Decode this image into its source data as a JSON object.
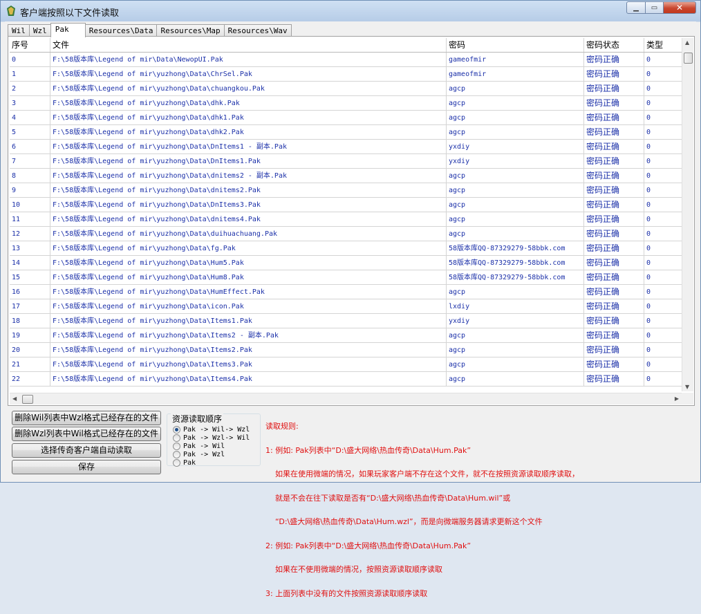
{
  "window": {
    "title": "客户端按照以下文件读取",
    "min_label": "▁",
    "max_label": "▭",
    "close_label": "✕"
  },
  "tabs": [
    "Wil",
    "Wzl",
    "Pak",
    "Resources\\Data",
    "Resources\\Map",
    "Resources\\Wav"
  ],
  "active_tab": "Pak",
  "table": {
    "headers": [
      "序号",
      "文件",
      "密码",
      "密码状态",
      "类型"
    ],
    "rows": [
      [
        "0",
        "F:\\58版本库\\Legend of mir\\Data\\NewopUI.Pak",
        "gameofmir",
        "密码正确",
        "0"
      ],
      [
        "1",
        "F:\\58版本库\\Legend of mir\\yuzhong\\Data\\ChrSel.Pak",
        "gameofmir",
        "密码正确",
        "0"
      ],
      [
        "2",
        "F:\\58版本库\\Legend of mir\\yuzhong\\Data\\chuangkou.Pak",
        "agcp",
        "密码正确",
        "0"
      ],
      [
        "3",
        "F:\\58版本库\\Legend of mir\\yuzhong\\Data\\dhk.Pak",
        "agcp",
        "密码正确",
        "0"
      ],
      [
        "4",
        "F:\\58版本库\\Legend of mir\\yuzhong\\Data\\dhk1.Pak",
        "agcp",
        "密码正确",
        "0"
      ],
      [
        "5",
        "F:\\58版本库\\Legend of mir\\yuzhong\\Data\\dhk2.Pak",
        "agcp",
        "密码正确",
        "0"
      ],
      [
        "6",
        "F:\\58版本库\\Legend of mir\\yuzhong\\Data\\DnItems1 - 副本.Pak",
        "yxdiy",
        "密码正确",
        "0"
      ],
      [
        "7",
        "F:\\58版本库\\Legend of mir\\yuzhong\\Data\\DnItems1.Pak",
        "yxdiy",
        "密码正确",
        "0"
      ],
      [
        "8",
        "F:\\58版本库\\Legend of mir\\yuzhong\\Data\\dnitems2 - 副本.Pak",
        "agcp",
        "密码正确",
        "0"
      ],
      [
        "9",
        "F:\\58版本库\\Legend of mir\\yuzhong\\Data\\dnitems2.Pak",
        "agcp",
        "密码正确",
        "0"
      ],
      [
        "10",
        "F:\\58版本库\\Legend of mir\\yuzhong\\Data\\DnItems3.Pak",
        "agcp",
        "密码正确",
        "0"
      ],
      [
        "11",
        "F:\\58版本库\\Legend of mir\\yuzhong\\Data\\dnitems4.Pak",
        "agcp",
        "密码正确",
        "0"
      ],
      [
        "12",
        "F:\\58版本库\\Legend of mir\\yuzhong\\Data\\duihuachuang.Pak",
        "agcp",
        "密码正确",
        "0"
      ],
      [
        "13",
        "F:\\58版本库\\Legend of mir\\yuzhong\\Data\\fg.Pak",
        "58版本库QQ-87329279-58bbk.com",
        "密码正确",
        "0"
      ],
      [
        "14",
        "F:\\58版本库\\Legend of mir\\yuzhong\\Data\\Hum5.Pak",
        "58版本库QQ-87329279-58bbk.com",
        "密码正确",
        "0"
      ],
      [
        "15",
        "F:\\58版本库\\Legend of mir\\yuzhong\\Data\\Hum8.Pak",
        "58版本库QQ-87329279-58bbk.com",
        "密码正确",
        "0"
      ],
      [
        "16",
        "F:\\58版本库\\Legend of mir\\yuzhong\\Data\\HumEffect.Pak",
        "agcp",
        "密码正确",
        "0"
      ],
      [
        "17",
        "F:\\58版本库\\Legend of mir\\yuzhong\\Data\\icon.Pak",
        "lxdiy",
        "密码正确",
        "0"
      ],
      [
        "18",
        "F:\\58版本库\\Legend of mir\\yuzhong\\Data\\Items1.Pak",
        "yxdiy",
        "密码正确",
        "0"
      ],
      [
        "19",
        "F:\\58版本库\\Legend of mir\\yuzhong\\Data\\Items2 - 副本.Pak",
        "agcp",
        "密码正确",
        "0"
      ],
      [
        "20",
        "F:\\58版本库\\Legend of mir\\yuzhong\\Data\\Items2.Pak",
        "agcp",
        "密码正确",
        "0"
      ],
      [
        "21",
        "F:\\58版本库\\Legend of mir\\yuzhong\\Data\\Items3.Pak",
        "agcp",
        "密码正确",
        "0"
      ],
      [
        "22",
        "F:\\58版本库\\Legend of mir\\yuzhong\\Data\\Items4.Pak",
        "agcp",
        "密码正确",
        "0"
      ]
    ]
  },
  "buttons": {
    "delete_wil": "删除Wil列表中Wzl格式已经存在的文件",
    "delete_wzl": "删除Wzl列表中Wil格式已经存在的文件",
    "select_client": "选择传奇客户端自动读取",
    "save": "保存"
  },
  "order_group": {
    "title": "资源读取顺序",
    "options": [
      "Pak -> Wil-> Wzl",
      "Pak -> Wzl-> Wil",
      "Pak -> Wil",
      "Pak -> Wzl",
      "Pak"
    ],
    "selected": "Pak -> Wil-> Wzl"
  },
  "rules": {
    "lines": [
      "读取规则:",
      "1: 例如: Pak列表中“D:\\盛大网络\\热血传奇\\Data\\Hum.Pak”",
      "    如果在使用微端的情况，如果玩家客户端不存在这个文件，就不在按照资源读取顺序读取，",
      "    就是不会在往下读取是否有“D:\\盛大网络\\热血传奇\\Data\\Hum.wil”或",
      "    “D:\\盛大网络\\热血传奇\\Data\\Hum.wzl”，而是向微端服务器请求更新这个文件",
      "2: 例如: Pak列表中“D:\\盛大网络\\热血传奇\\Data\\Hum.Pak”",
      "    如果在不使用微端的情况，按照资源读取顺序读取",
      "3: 上面列表中没有的文件按照资源读取顺序读取"
    ]
  }
}
